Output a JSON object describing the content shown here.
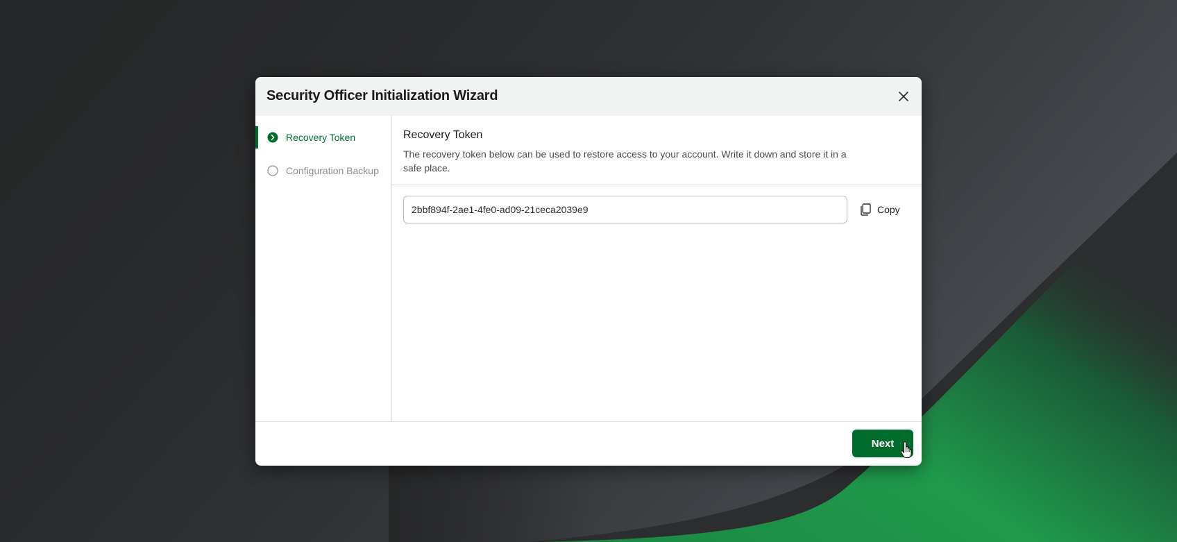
{
  "dialog": {
    "title": "Security Officer Initialization Wizard",
    "close_icon": "close-icon"
  },
  "steps": [
    {
      "label": "Recovery Token",
      "state": "active",
      "icon": "chevron-right-circle-icon"
    },
    {
      "label": "Configuration Backup",
      "state": "inactive",
      "icon": "empty-circle-icon"
    }
  ],
  "content": {
    "title": "Recovery Token",
    "description": "The recovery token below can be used to restore access to your account. Write it down and store it in a safe place.",
    "token_value": "2bbf894f-2ae1-4fe0-ad09-21ceca2039e9",
    "copy_label": "Copy",
    "copy_icon": "copy-icon"
  },
  "footer": {
    "next_label": "Next"
  },
  "colors": {
    "accent": "#006b2b",
    "active_text": "#00762f",
    "background": "#262728",
    "header": "#f1f2f2"
  }
}
